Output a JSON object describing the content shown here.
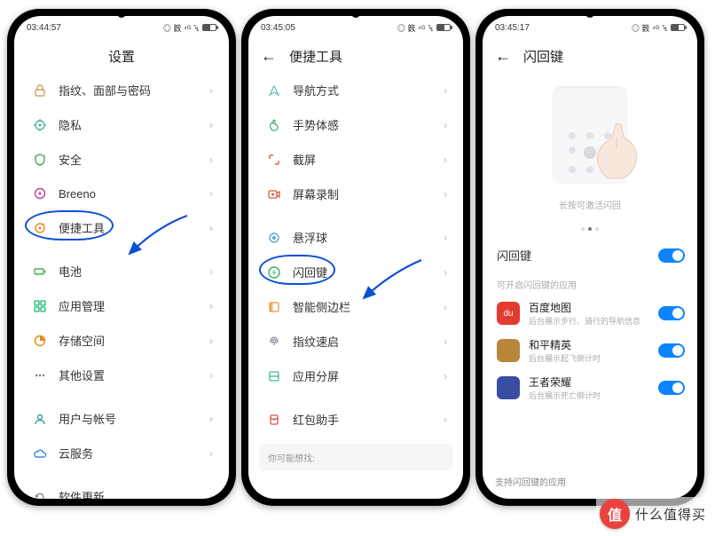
{
  "watermark": {
    "badge": "值",
    "text": "什么值得买"
  },
  "phones": [
    {
      "time": "03:44:57",
      "status_extra": "◎ 䉤 ⁴ᴳ ꔃ",
      "title": "设置",
      "groups": [
        [
          {
            "icon": "lock-icon",
            "icon_color": "#d1a35a",
            "label": "指纹、面部与密码"
          },
          {
            "icon": "privacy-icon",
            "icon_color": "#49b4a6",
            "label": "隐私"
          },
          {
            "icon": "shield-icon",
            "icon_color": "#4aa35a",
            "label": "安全"
          },
          {
            "icon": "breeano-icon",
            "icon_color": "#c03aa2",
            "label": "Breeno"
          },
          {
            "icon": "tools-icon",
            "icon_color": "#e88b1f",
            "label": "便捷工具",
            "highlight": true
          }
        ],
        [
          {
            "icon": "battery-icon",
            "icon_color": "#4caf50",
            "label": "电池"
          },
          {
            "icon": "apps-icon",
            "icon_color": "#18b46e",
            "label": "应用管理"
          },
          {
            "icon": "storage-icon",
            "icon_color": "#e58a1a",
            "label": "存储空间"
          },
          {
            "icon": "more-icon",
            "icon_color": "#888",
            "label": "其他设置"
          }
        ],
        [
          {
            "icon": "user-icon",
            "icon_color": "#3aa0a0",
            "label": "用户与帐号"
          },
          {
            "icon": "cloud-icon",
            "icon_color": "#3a8be0",
            "label": "云服务"
          }
        ],
        [
          {
            "icon": "update-icon",
            "icon_color": "#888",
            "label": "软件更新"
          }
        ]
      ]
    },
    {
      "time": "03:45:05",
      "status_extra": "◎ 䉤 ⁴ᴳ ꔃ",
      "title": "便捷工具",
      "items": [
        {
          "icon": "nav-icon",
          "icon_color": "#6fbfb4",
          "label": "导航方式"
        },
        {
          "icon": "gesture-icon",
          "icon_color": "#34b06e",
          "label": "手势体感"
        },
        {
          "icon": "screenshot-icon",
          "icon_color": "#e06a3a",
          "label": "截屏"
        },
        {
          "icon": "record-icon",
          "icon_color": "#d65a3c",
          "label": "屏幕录制"
        },
        {
          "sep": true
        },
        {
          "icon": "float-icon",
          "icon_color": "#5aa7d6",
          "label": "悬浮球"
        },
        {
          "icon": "flash-icon",
          "icon_color": "#2fb56b",
          "label": "闪回键",
          "highlight": true
        },
        {
          "icon": "sidebar-icon",
          "icon_color": "#e09a3a",
          "label": "智能侧边栏"
        },
        {
          "icon": "fingerprint-icon",
          "icon_color": "#7a7f8a",
          "label": "指纹速启"
        },
        {
          "icon": "split-icon",
          "icon_color": "#3fb89a",
          "label": "应用分屏"
        },
        {
          "sep": true
        },
        {
          "icon": "redpacket-icon",
          "icon_color": "#d65050",
          "label": "红包助手"
        }
      ],
      "hint": "你可能想找:"
    },
    {
      "time": "03:45:17",
      "status_extra": "◎ 䉤 ⁴ᴳ ꔃ",
      "title": "闪回键",
      "caption": "长按可激活闪回",
      "main_toggle": "闪回键",
      "section_note": "可开启闪回键的应用",
      "apps": [
        {
          "name": "百度地图",
          "sub": "后台展示步行、骑行的导航信息",
          "color": "#e43b2f",
          "mark": "du"
        },
        {
          "name": "和平精英",
          "sub": "后台展示起飞倒计时",
          "color": "#b8873a",
          "mark": ""
        },
        {
          "name": "王者荣耀",
          "sub": "后台展示死亡倒计时",
          "color": "#3a4ea1",
          "mark": ""
        }
      ],
      "footer": "支持闪回键的应用"
    }
  ]
}
